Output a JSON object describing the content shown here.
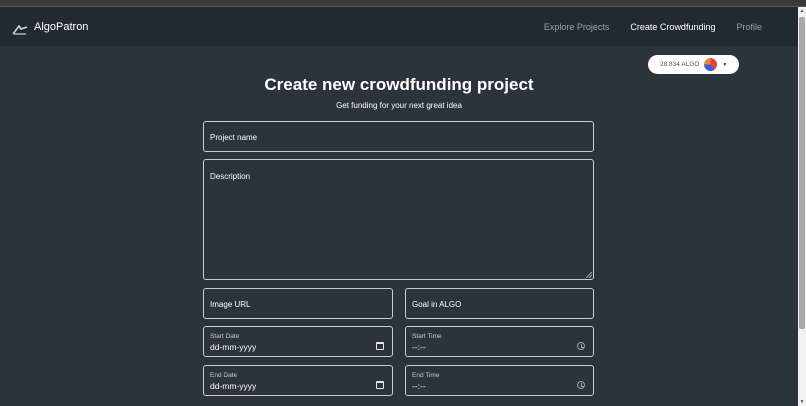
{
  "brand": {
    "name": "AlgoPatron",
    "logo_icon": "algo-logo-icon"
  },
  "nav": {
    "items": [
      {
        "label": "Explore Projects",
        "active": false
      },
      {
        "label": "Create Crowdfunding",
        "active": true
      },
      {
        "label": "Profile",
        "active": false
      }
    ]
  },
  "wallet": {
    "balance": "28.834 ALGO"
  },
  "page": {
    "title": "Create new crowdfunding project",
    "subtitle": "Get funding for your next great idea"
  },
  "form": {
    "project_name": {
      "placeholder": "Project name",
      "value": ""
    },
    "description": {
      "placeholder": "Description",
      "value": ""
    },
    "image_url": {
      "placeholder": "Image URL",
      "value": ""
    },
    "goal": {
      "placeholder": "Goal in ALGO",
      "value": ""
    },
    "start_date": {
      "label": "Start Date",
      "value": "dd-mm-yyyy"
    },
    "start_time": {
      "label": "Start Time",
      "value": "--:--"
    },
    "end_date": {
      "label": "End Date",
      "value": "dd-mm-yyyy"
    },
    "end_time": {
      "label": "End Time",
      "value": "--:--"
    }
  },
  "colors": {
    "background": "#2b3438",
    "navbar": "#212a2e",
    "border": "#c9cdd0",
    "text": "#ffffff",
    "muted": "#9aa3a8"
  }
}
